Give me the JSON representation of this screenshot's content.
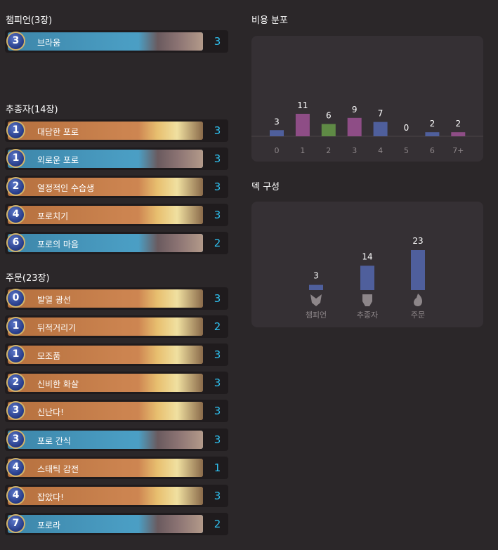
{
  "champions": {
    "title": "챔피언(3장)",
    "cards": [
      {
        "cost": "3",
        "name": "브라움",
        "count": "3",
        "color": "blue"
      }
    ]
  },
  "followers": {
    "title": "추종자(14장)",
    "cards": [
      {
        "cost": "1",
        "name": "대담한 포로",
        "count": "3",
        "color": "orange"
      },
      {
        "cost": "1",
        "name": "외로운 포로",
        "count": "3",
        "color": "blue"
      },
      {
        "cost": "2",
        "name": "열정적인 수습생",
        "count": "3",
        "color": "orange"
      },
      {
        "cost": "4",
        "name": "포로치기",
        "count": "3",
        "color": "orange"
      },
      {
        "cost": "6",
        "name": "포로의 마음",
        "count": "2",
        "color": "blue"
      }
    ]
  },
  "spells": {
    "title": "주문(23장)",
    "cards": [
      {
        "cost": "0",
        "name": "발열 광선",
        "count": "3",
        "color": "orange"
      },
      {
        "cost": "1",
        "name": "뒤적거리기",
        "count": "2",
        "color": "orange"
      },
      {
        "cost": "1",
        "name": "모조품",
        "count": "3",
        "color": "orange"
      },
      {
        "cost": "2",
        "name": "신비한 화살",
        "count": "3",
        "color": "orange"
      },
      {
        "cost": "3",
        "name": "신난다!",
        "count": "3",
        "color": "orange"
      },
      {
        "cost": "3",
        "name": "포로 간식",
        "count": "3",
        "color": "blue"
      },
      {
        "cost": "4",
        "name": "스태틱 감전",
        "count": "1",
        "color": "orange"
      },
      {
        "cost": "4",
        "name": "잡았다!",
        "count": "3",
        "color": "orange"
      },
      {
        "cost": "7",
        "name": "포로라",
        "count": "2",
        "color": "blue"
      }
    ]
  },
  "cost_distribution": {
    "title": "비용 분포",
    "chart_data": {
      "type": "bar",
      "categories": [
        "0",
        "1",
        "2",
        "3",
        "4",
        "5",
        "6",
        "7+"
      ],
      "values": [
        3,
        11,
        6,
        9,
        7,
        0,
        2,
        2
      ],
      "colors": [
        "#4f5f9c",
        "#8e4d86",
        "#5f8a45",
        "#8e4d86",
        "#4f5f9c",
        "#4f5f9c",
        "#4f5f9c",
        "#8e4d86"
      ]
    }
  },
  "deck_composition": {
    "title": "덱 구성",
    "chart_data": {
      "type": "bar",
      "categories": [
        "챔피언",
        "추종자",
        "주문"
      ],
      "values": [
        3,
        14,
        23
      ],
      "color": "#4f5f9c"
    },
    "icons": [
      "champion-icon",
      "follower-icon",
      "spell-icon"
    ]
  }
}
